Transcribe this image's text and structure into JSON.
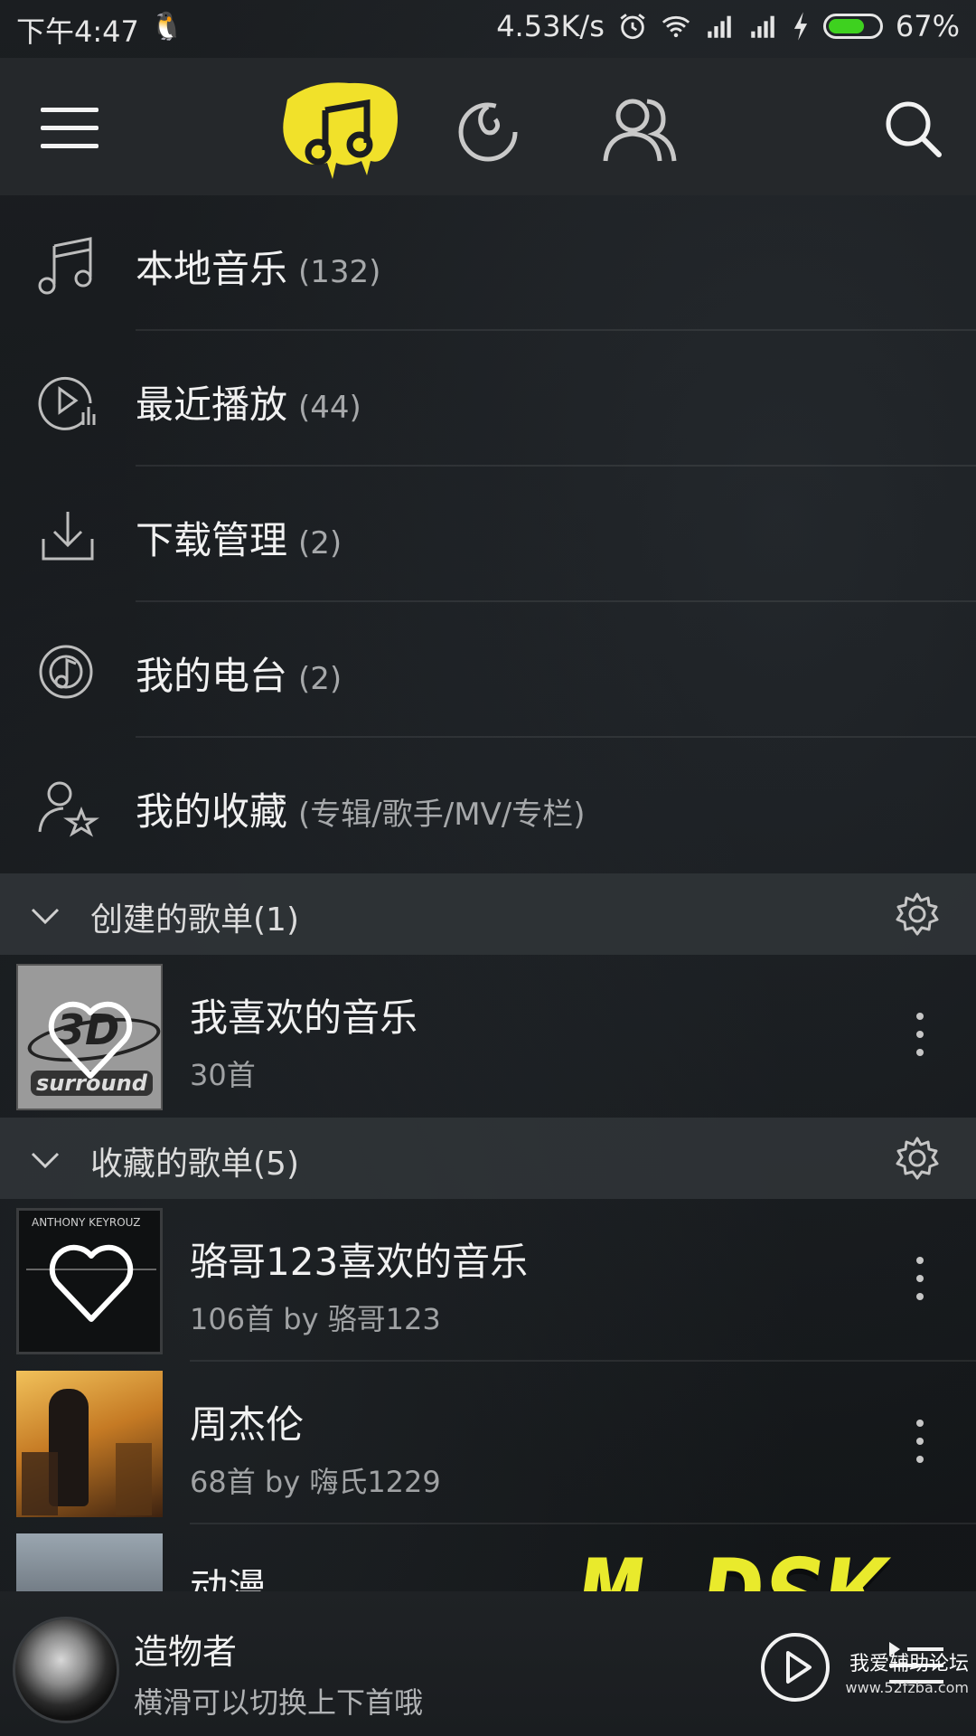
{
  "status_bar": {
    "time": "下午4:47",
    "net_speed": "4.53K/s",
    "battery": "67%",
    "battery_level": 0.67,
    "battery_color": "#3ed11f"
  },
  "top_nav": {
    "icons": [
      "menu-icon",
      "music-note-icon",
      "netease-discover-icon",
      "friends-icon",
      "search-icon"
    ],
    "accent": "#f1e12a"
  },
  "menu": {
    "items": [
      {
        "label": "本地音乐",
        "count": "(132)",
        "icon": "music-note-outline-icon"
      },
      {
        "label": "最近播放",
        "count": "(44)",
        "icon": "recent-play-icon"
      },
      {
        "label": "下载管理",
        "count": "(2)",
        "icon": "download-icon"
      },
      {
        "label": "我的电台",
        "count": "(2)",
        "icon": "radio-icon"
      },
      {
        "label": "我的收藏",
        "count": "(专辑/歌手/MV/专栏)",
        "icon": "user-star-icon"
      }
    ]
  },
  "created_section": {
    "label": "创建的歌单(1)",
    "playlists": [
      {
        "title": "我喜欢的音乐",
        "subtitle": "30首",
        "cover_text": "3D",
        "cover_subtext": "surround"
      }
    ]
  },
  "collected_section": {
    "label": "收藏的歌单(5)",
    "playlists": [
      {
        "title": "骆哥123喜欢的音乐",
        "subtitle": "106首 by 骆哥123",
        "cover_text": "ANTHONY KEYROUZ"
      },
      {
        "title": "周杰伦",
        "subtitle": "68首 by 嗨氏1229"
      },
      {
        "title": "动漫"
      }
    ]
  },
  "player": {
    "song": "造物者",
    "hint": "横滑可以切换上下首哦"
  },
  "overlay": {
    "graffiti": "M.DSK",
    "watermark": "我爱辅助论坛",
    "watermark_url": "www.52fzba.com"
  }
}
